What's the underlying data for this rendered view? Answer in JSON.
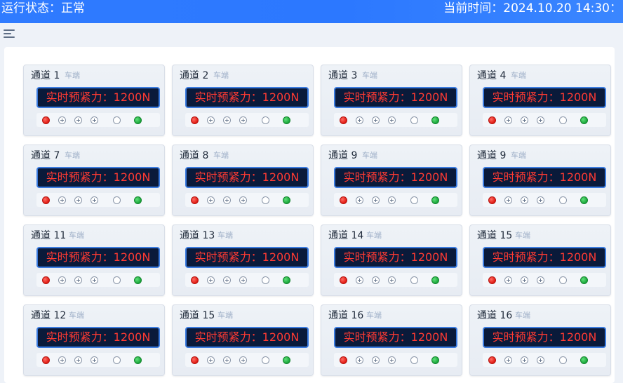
{
  "header": {
    "status_text": "运行状态：正常",
    "time_text": "当前时间：2024.10.20 14:30："
  },
  "colors": {
    "header_blue": "#2f7bff",
    "display_bg": "#0a1a3a",
    "display_border": "#3a7be0",
    "display_text": "#ff3a32",
    "indicator_red": "#e11a12",
    "indicator_green": "#1aa63a"
  },
  "icons": {
    "menu": "menu-icon",
    "add": "plus-circle-icon"
  },
  "cards": [
    {
      "title": "通道 1",
      "subtitle": "车端",
      "display": "实时预紧力：1200N"
    },
    {
      "title": "通道 2",
      "subtitle": "车端",
      "display": "实时预紧力：1200N"
    },
    {
      "title": "通道 3",
      "subtitle": "车端",
      "display": "实时预紧力：1200N"
    },
    {
      "title": "通道 4",
      "subtitle": "车端",
      "display": "实时预紧力：1200N"
    },
    {
      "title": "通道 7",
      "subtitle": "车端",
      "display": "实时预紧力：1200N"
    },
    {
      "title": "通道 8",
      "subtitle": "车端",
      "display": "实时预紧力：1200N"
    },
    {
      "title": "通道 9",
      "subtitle": "车端",
      "display": "实时预紧力：1200N"
    },
    {
      "title": "通道 9",
      "subtitle": "车端",
      "display": "实时预紧力：1200N"
    },
    {
      "title": "通道 11",
      "subtitle": "车端",
      "display": "实时预紧力：1200N"
    },
    {
      "title": "通道 13",
      "subtitle": "车端",
      "display": "实时预紧力：1200N"
    },
    {
      "title": "通道 14",
      "subtitle": "车端",
      "display": "实时预紧力：1200N"
    },
    {
      "title": "通道 15",
      "subtitle": "车端",
      "display": "实时预紧力：1200N"
    },
    {
      "title": "通道 12",
      "subtitle": "车端",
      "display": "实时预紧力：1200N"
    },
    {
      "title": "通道 15",
      "subtitle": "车端",
      "display": "实时预紧力：1200N"
    },
    {
      "title": "通道 16",
      "subtitle": "车端",
      "display": "实时预紧力：1200N"
    },
    {
      "title": "通道 16",
      "subtitle": "车端",
      "display": "实时预紧力：1200N"
    }
  ]
}
